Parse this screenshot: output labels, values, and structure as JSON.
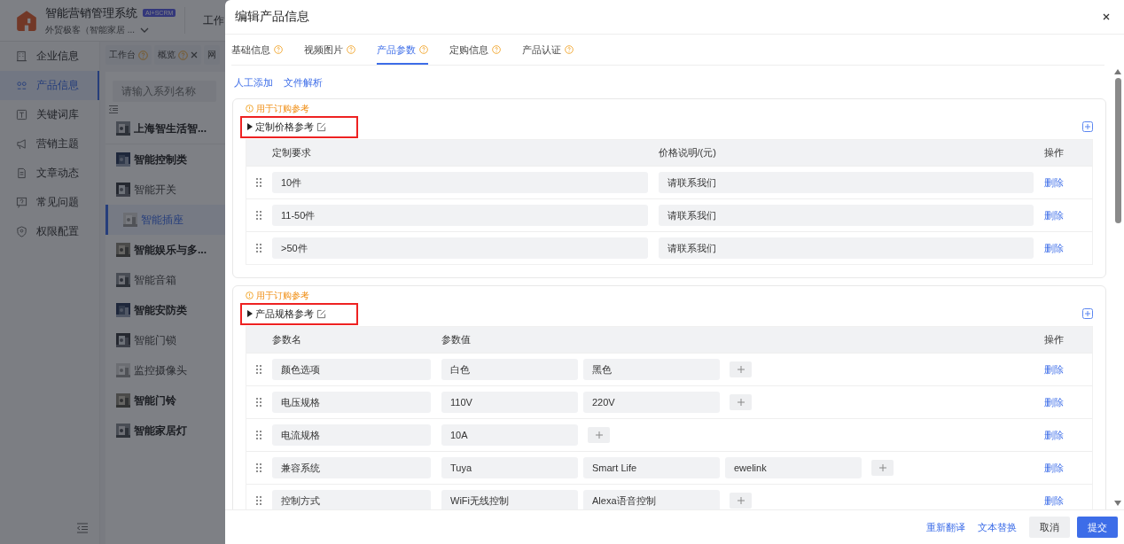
{
  "app": {
    "title": "智能营销管理系统",
    "badge": "AI+SCRM",
    "account": "外贸极客（智能家居 ...",
    "header_tab": "工作"
  },
  "sidebar": {
    "items": [
      {
        "label": "企业信息",
        "selected": false
      },
      {
        "label": "产品信息",
        "selected": true
      },
      {
        "label": "关键词库",
        "selected": false
      },
      {
        "label": "营销主题",
        "selected": false
      },
      {
        "label": "文章动态",
        "selected": false
      },
      {
        "label": "常见问题",
        "selected": false
      },
      {
        "label": "权限配置",
        "selected": false
      }
    ]
  },
  "page_tabs": [
    {
      "label": "工作台",
      "help": true,
      "closable": false
    },
    {
      "label": "概览",
      "help": true,
      "closable": true
    },
    {
      "label": "网",
      "help": false,
      "closable": false
    }
  ],
  "series_search": {
    "placeholder": "请输入系列名称"
  },
  "series": [
    {
      "label": "上海智生活智...",
      "kind": "company",
      "selected": false
    },
    {
      "label": "智能控制类",
      "kind": "category",
      "selected": false
    },
    {
      "label": "智能开关",
      "kind": "item",
      "selected": false
    },
    {
      "label": "智能插座",
      "kind": "item",
      "selected": true
    },
    {
      "label": "智能娱乐与多...",
      "kind": "category",
      "selected": false
    },
    {
      "label": "智能音箱",
      "kind": "item",
      "selected": false
    },
    {
      "label": "智能安防类",
      "kind": "category",
      "selected": false
    },
    {
      "label": "智能门锁",
      "kind": "item",
      "selected": false
    },
    {
      "label": "监控摄像头",
      "kind": "item",
      "selected": false
    },
    {
      "label": "智能门铃",
      "kind": "category",
      "selected": false
    },
    {
      "label": "智能家居灯",
      "kind": "category",
      "selected": false
    }
  ],
  "drawer": {
    "title": "编辑产品信息",
    "tabs": [
      {
        "label": "基础信息",
        "selected": false
      },
      {
        "label": "视频图片",
        "selected": false
      },
      {
        "label": "产品参数",
        "selected": true
      },
      {
        "label": "定购信息",
        "selected": false
      },
      {
        "label": "产品认证",
        "selected": false
      }
    ],
    "links": [
      "人工添加",
      "文件解析"
    ],
    "sections": [
      {
        "kind": "price",
        "note": "用于订购参考",
        "title": "定制价格参考",
        "highlighted": true,
        "columns": [
          "定制要求",
          "价格说明/(元)",
          "操作"
        ],
        "rows": [
          {
            "requirement": "10件",
            "price": "请联系我们",
            "action": "删除"
          },
          {
            "requirement": "11-50件",
            "price": "请联系我们",
            "action": "删除"
          },
          {
            "requirement": ">50件",
            "price": "请联系我们",
            "action": "删除"
          }
        ]
      },
      {
        "kind": "spec",
        "note": "用于订购参考",
        "title": "产品规格参考",
        "highlighted": true,
        "columns": [
          "参数名",
          "参数值",
          "操作"
        ],
        "rows": [
          {
            "name": "颜色选项",
            "values": [
              "白色",
              "黑色"
            ],
            "action": "删除"
          },
          {
            "name": "电压规格",
            "values": [
              "110V",
              "220V"
            ],
            "action": "删除"
          },
          {
            "name": "电流规格",
            "values": [
              "10A"
            ],
            "action": "删除"
          },
          {
            "name": "兼容系统",
            "values": [
              "Tuya",
              "Smart Life",
              "ewelink"
            ],
            "action": "删除"
          },
          {
            "name": "控制方式",
            "values": [
              "WiFi无线控制",
              "Alexa语音控制"
            ],
            "action": "删除"
          }
        ]
      }
    ],
    "footer": {
      "links": [
        "重新翻译",
        "文本替换"
      ],
      "cancel": "取消",
      "submit": "提交"
    }
  }
}
